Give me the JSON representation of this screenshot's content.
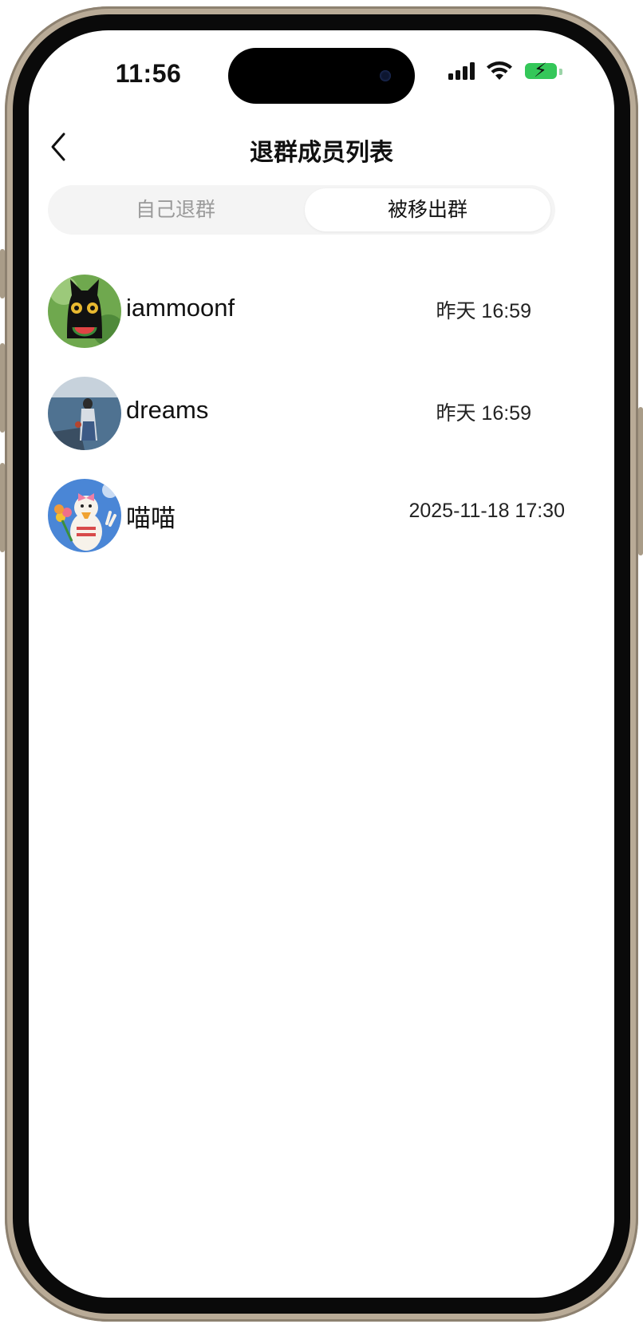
{
  "status_bar": {
    "time": "11:56",
    "icons": [
      "signal-icon",
      "wifi-icon",
      "battery-charging-icon"
    ],
    "battery_color": "#34c759"
  },
  "header": {
    "back_icon": "chevron-left-icon",
    "title": "退群成员列表"
  },
  "tabs": [
    {
      "label": "自己退群",
      "active": false
    },
    {
      "label": "被移出群",
      "active": true
    }
  ],
  "members": [
    {
      "name": "iammoonf",
      "time": "昨天 16:59",
      "avatar": "black-cat-avatar"
    },
    {
      "name": "dreams",
      "time": "昨天 16:59",
      "avatar": "seaside-girl-avatar"
    },
    {
      "name": "喵喵",
      "time": "2025-11-18 17:30",
      "avatar": "duck-tulip-avatar"
    }
  ],
  "colors": {
    "text_primary": "#111111",
    "tab_inactive_text": "#9a9a9a",
    "segment_bg": "#f4f4f4"
  }
}
